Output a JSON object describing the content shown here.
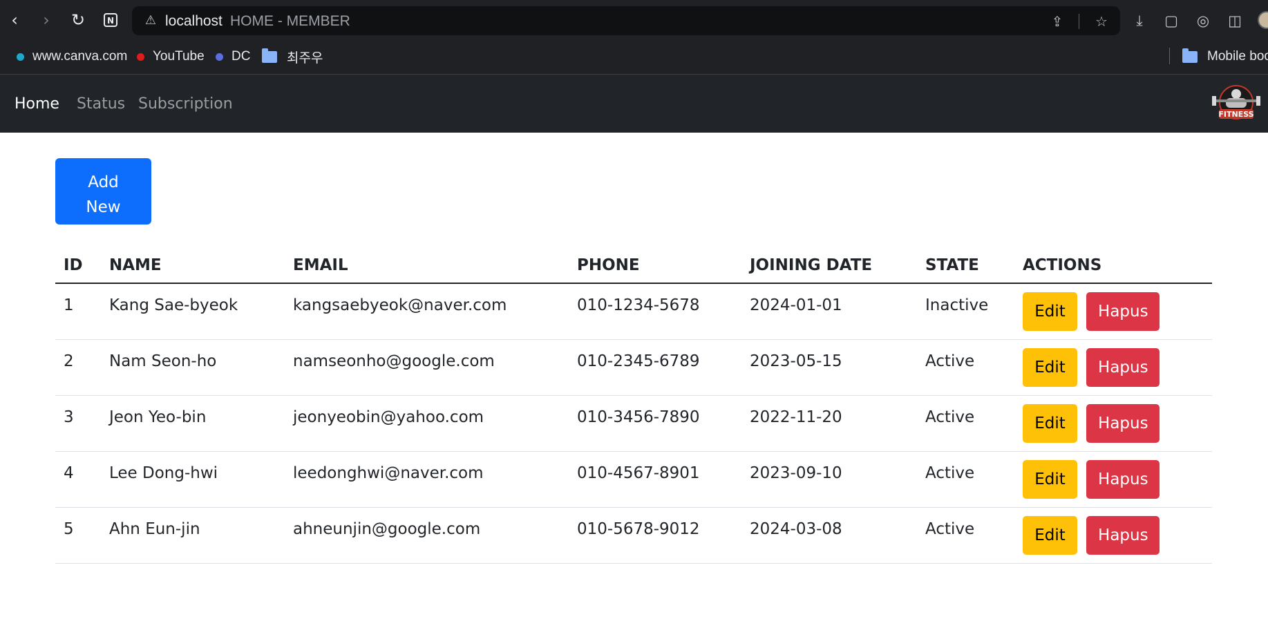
{
  "browser": {
    "host": "localhost",
    "tab_title": "HOME - MEMBER",
    "bookmarks": [
      {
        "label": "www.canva.com",
        "dot_color": "#1fa9c9"
      },
      {
        "label": "YouTube",
        "dot_color": "#e01b1b"
      },
      {
        "label": "DC",
        "dot_color": "#5b6ee1"
      },
      {
        "label": "최주우",
        "icon": "folder-icon"
      }
    ],
    "bookmarks_overflow": "Mobile bookmarks"
  },
  "navbar": {
    "links": [
      {
        "label": "Home",
        "active": true
      },
      {
        "label": "Status",
        "active": false
      },
      {
        "label": "Subscription",
        "active": false
      }
    ],
    "logo_text": "FITNESS"
  },
  "add_button": {
    "line1": "Add",
    "line2": "New"
  },
  "table": {
    "headers": {
      "id": "ID",
      "name": "NAME",
      "email": "EMAIL",
      "phone": "PHONE",
      "joining_date": "JOINING DATE",
      "state": "STATE",
      "actions": "ACTIONS"
    },
    "rows": [
      {
        "id": "1",
        "name": "Kang Sae-byeok",
        "email": "kangsaebyeok@naver.com",
        "phone": "010-1234-5678",
        "joining_date": "2024-01-01",
        "state": "Inactive"
      },
      {
        "id": "2",
        "name": "Nam Seon-ho",
        "email": "namseonho@google.com",
        "phone": "010-2345-6789",
        "joining_date": "2023-05-15",
        "state": "Active"
      },
      {
        "id": "3",
        "name": "Jeon Yeo-bin",
        "email": "jeonyeobin@yahoo.com",
        "phone": "010-3456-7890",
        "joining_date": "2022-11-20",
        "state": "Active"
      },
      {
        "id": "4",
        "name": "Lee Dong-hwi",
        "email": "leedonghwi@naver.com",
        "phone": "010-4567-8901",
        "joining_date": "2023-09-10",
        "state": "Active"
      },
      {
        "id": "5",
        "name": "Ahn Eun-jin",
        "email": "ahneunjin@google.com",
        "phone": "010-5678-9012",
        "joining_date": "2024-03-08",
        "state": "Active"
      }
    ],
    "edit_label": "Edit",
    "delete_label": "Hapus"
  },
  "colors": {
    "primary": "#0d6efd",
    "warning": "#ffc107",
    "danger": "#dc3545",
    "navbar": "#212529"
  }
}
